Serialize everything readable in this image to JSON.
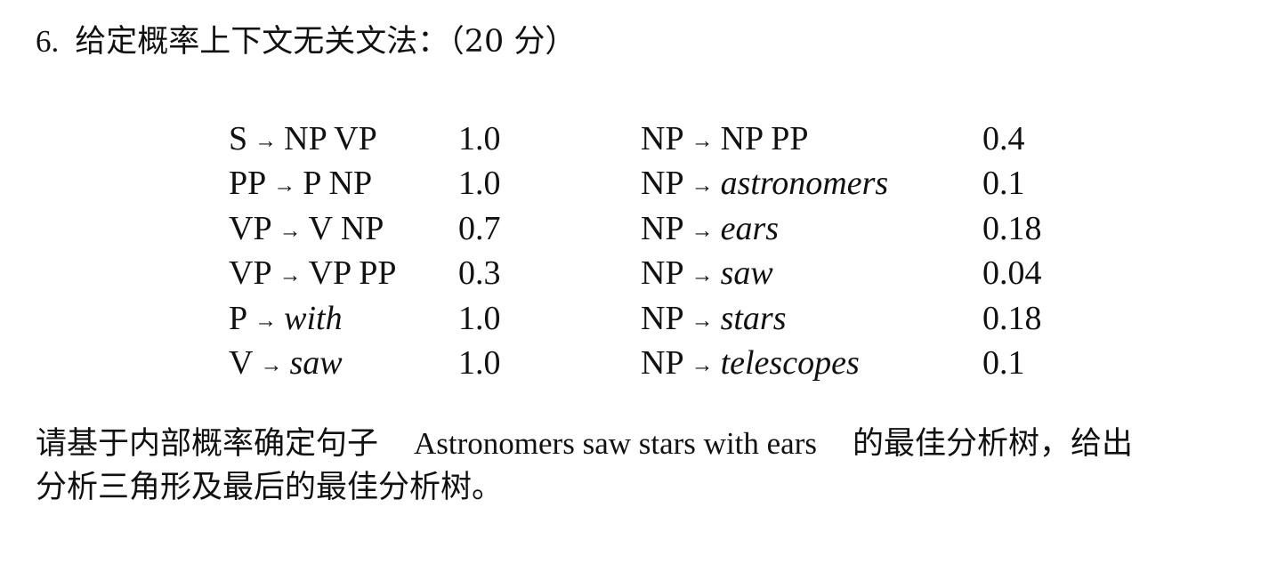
{
  "question": {
    "number": "6.",
    "title": "给定概率上下文无关文法：（20 分）"
  },
  "grammar": {
    "left_rules": [
      {
        "lhs": "S",
        "arrow": "→",
        "rhs": "NP VP",
        "italic": false,
        "prob": "1.0"
      },
      {
        "lhs": "PP",
        "arrow": "→",
        "rhs": "P NP",
        "italic": false,
        "prob": "1.0"
      },
      {
        "lhs": "VP",
        "arrow": "→",
        "rhs": "V NP",
        "italic": false,
        "prob": "0.7"
      },
      {
        "lhs": "VP",
        "arrow": "→",
        "rhs": "VP PP",
        "italic": false,
        "prob": "0.3"
      },
      {
        "lhs": "P",
        "arrow": "→",
        "rhs": "with",
        "italic": true,
        "prob": "1.0"
      },
      {
        "lhs": "V",
        "arrow": "→",
        "rhs": "saw",
        "italic": true,
        "prob": "1.0"
      }
    ],
    "right_rules": [
      {
        "lhs": "NP",
        "arrow": "→",
        "rhs": "NP PP",
        "italic": false,
        "prob": "0.4"
      },
      {
        "lhs": "NP",
        "arrow": "→",
        "rhs": "astronomers",
        "italic": true,
        "prob": "0.1"
      },
      {
        "lhs": "NP",
        "arrow": "→",
        "rhs": "ears",
        "italic": true,
        "prob": "0.18"
      },
      {
        "lhs": "NP",
        "arrow": "→",
        "rhs": "saw",
        "italic": true,
        "prob": "0.04"
      },
      {
        "lhs": "NP",
        "arrow": "→",
        "rhs": "stars",
        "italic": true,
        "prob": "0.18"
      },
      {
        "lhs": "NP",
        "arrow": "→",
        "rhs": "telescopes",
        "italic": true,
        "prob": "0.1"
      }
    ]
  },
  "task": {
    "line1_prefix": "请基于内部概率确定句子",
    "sentence": "Astronomers saw stars with ears",
    "line1_suffix": "的最佳分析树，给出",
    "line2": "分析三角形及最后的最佳分析树。"
  }
}
